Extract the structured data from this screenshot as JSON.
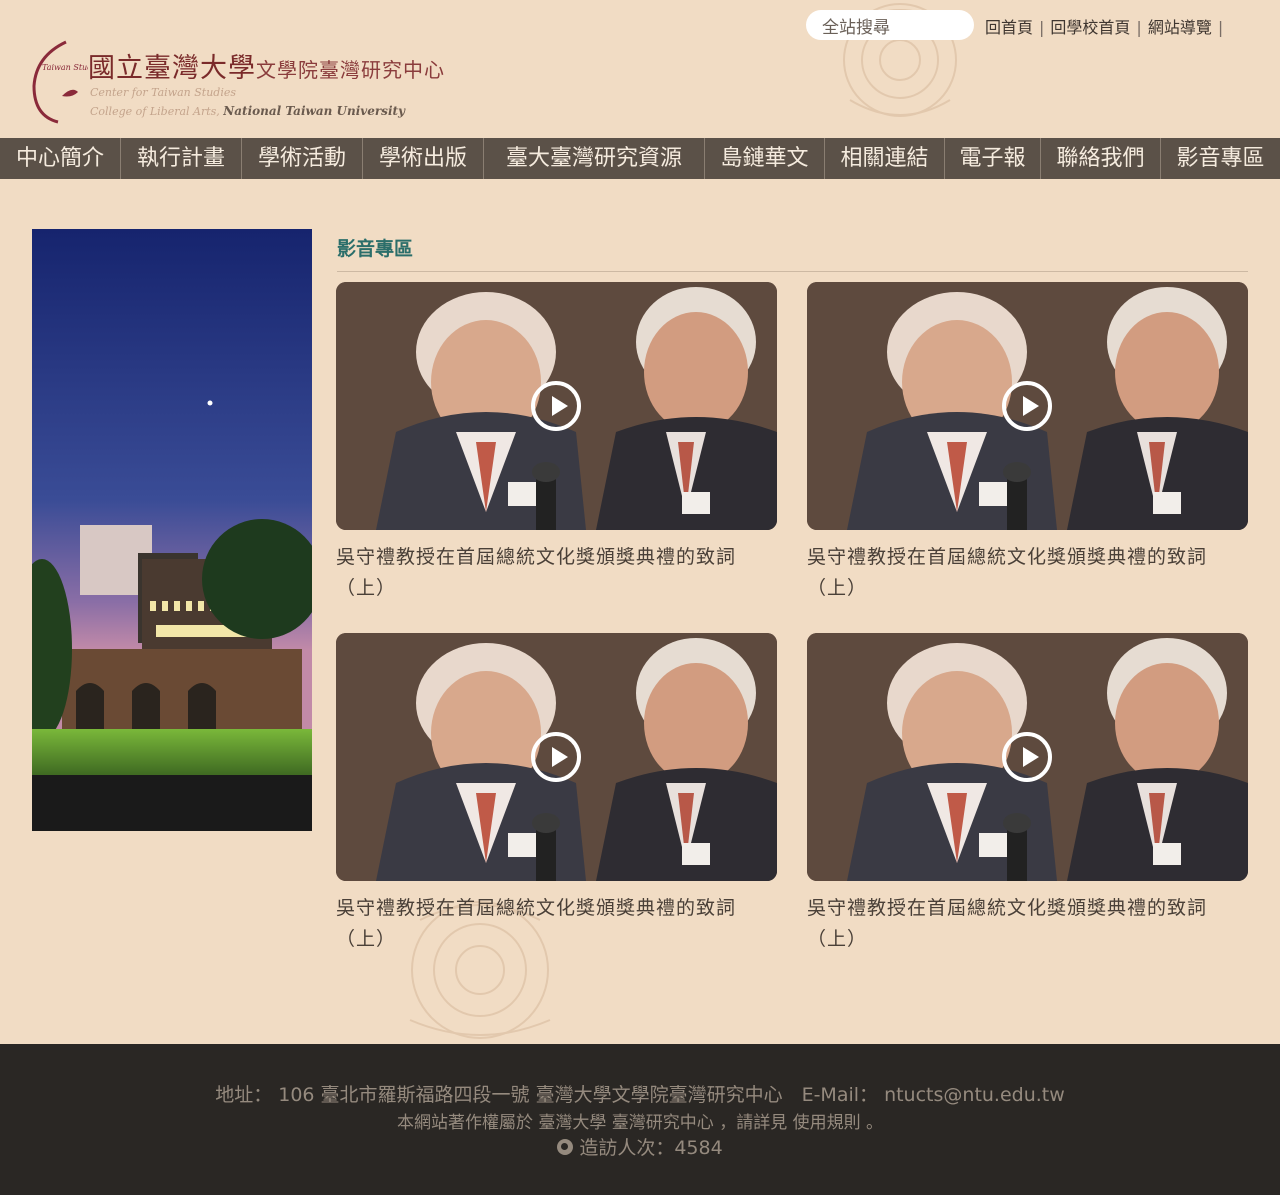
{
  "header": {
    "logo_title_main": "國立臺灣大學",
    "logo_title_sub": "文學院臺灣研究中心",
    "logo_en_line1": "Center for Taiwan Studies",
    "logo_en_line2_part1": "College of Liberal Arts,",
    "logo_en_line2_part2": "National Taiwan University",
    "logo_mark_text": "Taiwan Studies",
    "search_placeholder": "全站搜尋",
    "links": [
      "回首頁",
      "回學校首頁",
      "網站導覽"
    ]
  },
  "nav": {
    "items": [
      "中心簡介",
      "執行計畫",
      "學術活動",
      "學術出版",
      "臺大臺灣研究資源",
      "島鏈華文",
      "相關連結",
      "電子報",
      "聯絡我們",
      "影音專區"
    ]
  },
  "main": {
    "section_title": "影音專區",
    "videos": [
      {
        "title": "吳守禮教授在首屆總統文化獎頒獎典禮的致詞（上）"
      },
      {
        "title": "吳守禮教授在首屆總統文化獎頒獎典禮的致詞（上）"
      },
      {
        "title": "吳守禮教授在首屆總統文化獎頒獎典禮的致詞（上）"
      },
      {
        "title": "吳守禮教授在首屆總統文化獎頒獎典禮的致詞（上）"
      }
    ]
  },
  "footer": {
    "address": "地址： 106 臺北市羅斯福路四段一號 臺灣大學文學院臺灣研究中心　E-Mail： ntucts@ntu.edu.tw",
    "copyright": "本網站著作權屬於 臺灣大學 臺灣研究中心 ，請詳見 使用規則 。",
    "visitors_label": "造訪人次：4584"
  },
  "colors": {
    "background": "#f1dcc4",
    "nav_bg": "#5b5148",
    "accent_teal": "#2b6e6a",
    "footer_bg": "#2a2724"
  }
}
